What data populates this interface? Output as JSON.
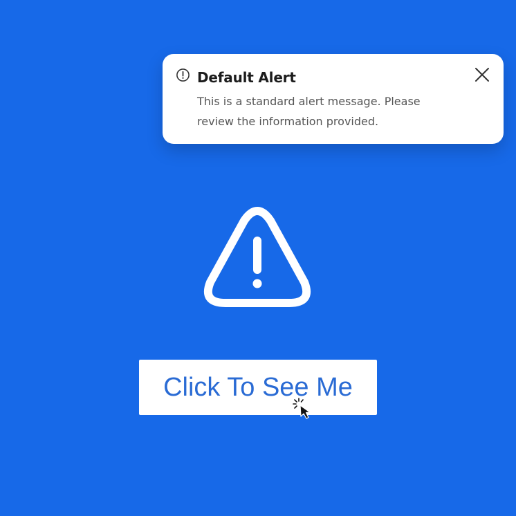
{
  "alert": {
    "icon": "alert-circle-icon",
    "title": "Default Alert",
    "message": "This is a standard alert message. Please review the information provided.",
    "close_icon": "close-icon"
  },
  "hero": {
    "icon": "warning-triangle-icon"
  },
  "cta": {
    "label": "Click To See Me"
  },
  "cursor": {
    "icon": "click-cursor-icon"
  },
  "colors": {
    "background": "#1769e8",
    "alert_background": "#ffffff",
    "title": "#1c1c1c",
    "message": "#555555",
    "button_text": "#2a6bd4"
  }
}
